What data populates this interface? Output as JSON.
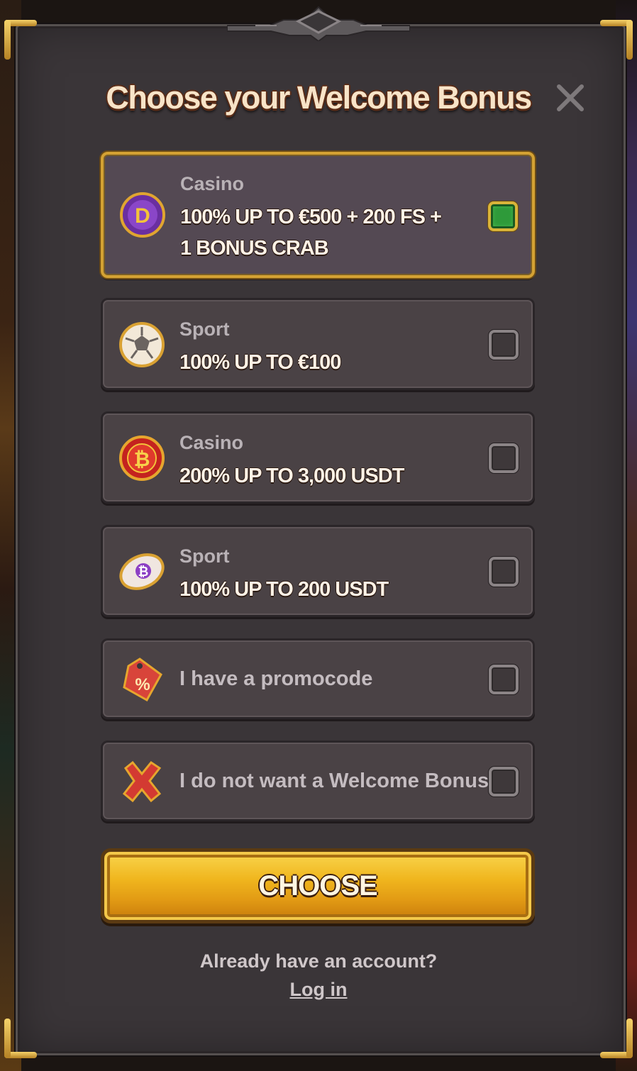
{
  "dialog": {
    "title": "Choose your Welcome Bonus",
    "close_icon": "close-icon"
  },
  "options": [
    {
      "category": "Casino",
      "value_line1": "100% UP TO €500 + 200 FS +",
      "value_line2": "1 BONUS CRAB",
      "icon": "dog-coin-icon",
      "selected": true
    },
    {
      "category": "Sport",
      "value_line1": "100% UP TO €100",
      "icon": "soccer-ball-icon",
      "selected": false
    },
    {
      "category": "Casino",
      "value_line1": "200% UP TO 3,000 USDT",
      "icon": "bitcoin-chip-icon",
      "selected": false
    },
    {
      "category": "Sport",
      "value_line1": "100% UP TO 200 USDT",
      "icon": "bitcoin-football-icon",
      "selected": false
    },
    {
      "label": "I have a promocode",
      "icon": "percent-tag-icon",
      "selected": false
    },
    {
      "label": "I do not want a Welcome Bonus",
      "icon": "red-x-icon",
      "selected": false
    }
  ],
  "actions": {
    "choose_label": "CHOOSE",
    "account_question": "Already have an account?",
    "login_label": "Log in"
  },
  "colors": {
    "panel": "#3a3538",
    "accent_gold": "#d4a233",
    "check_green": "#2e9a3a"
  }
}
